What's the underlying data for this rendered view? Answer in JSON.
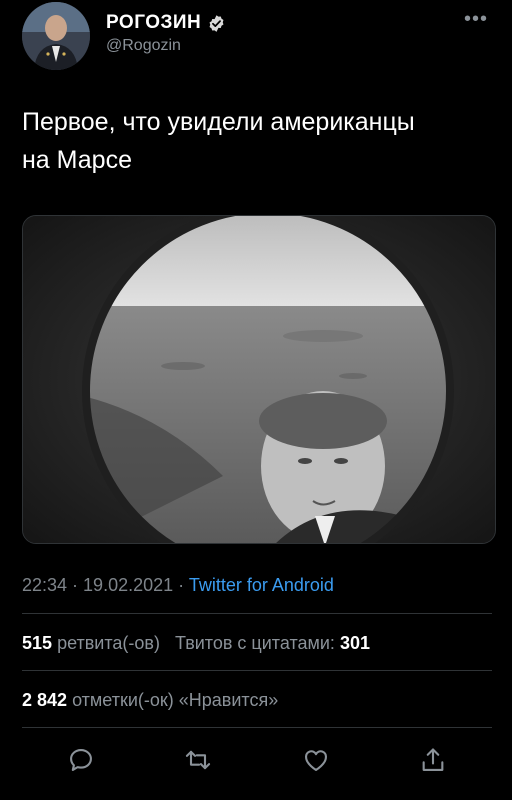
{
  "profile": {
    "display_name": "РОГОЗИН",
    "handle": "@Rogozin",
    "verified_icon": "verified-badge-icon",
    "avatar_icon": "avatar"
  },
  "more_icon": "more-horizontal-icon",
  "tweet": {
    "text_line1": "Первое, что увидели американцы",
    "text_line2": "на Марсе"
  },
  "meta": {
    "time": "22:34",
    "separator1": " · ",
    "date": "19.02.2021",
    "separator2": " · ",
    "source": "Twitter for Android"
  },
  "stats": {
    "retweets_count": "515",
    "retweets_label": "ретвита(-ов)",
    "quotes_label": "Твитов с цитатами:",
    "quotes_count": "301",
    "likes_count": "2 842",
    "likes_label": "отметки(-ок) «Нравится»"
  },
  "actions": [
    {
      "icon": "reply-icon"
    },
    {
      "icon": "retweet-icon"
    },
    {
      "icon": "like-icon"
    },
    {
      "icon": "share-icon"
    }
  ],
  "colors": {
    "background": "#000000",
    "text": "#e7e9ea",
    "secondary": "#8b9299",
    "link": "#3b9cf0",
    "divider": "#2f3336"
  }
}
